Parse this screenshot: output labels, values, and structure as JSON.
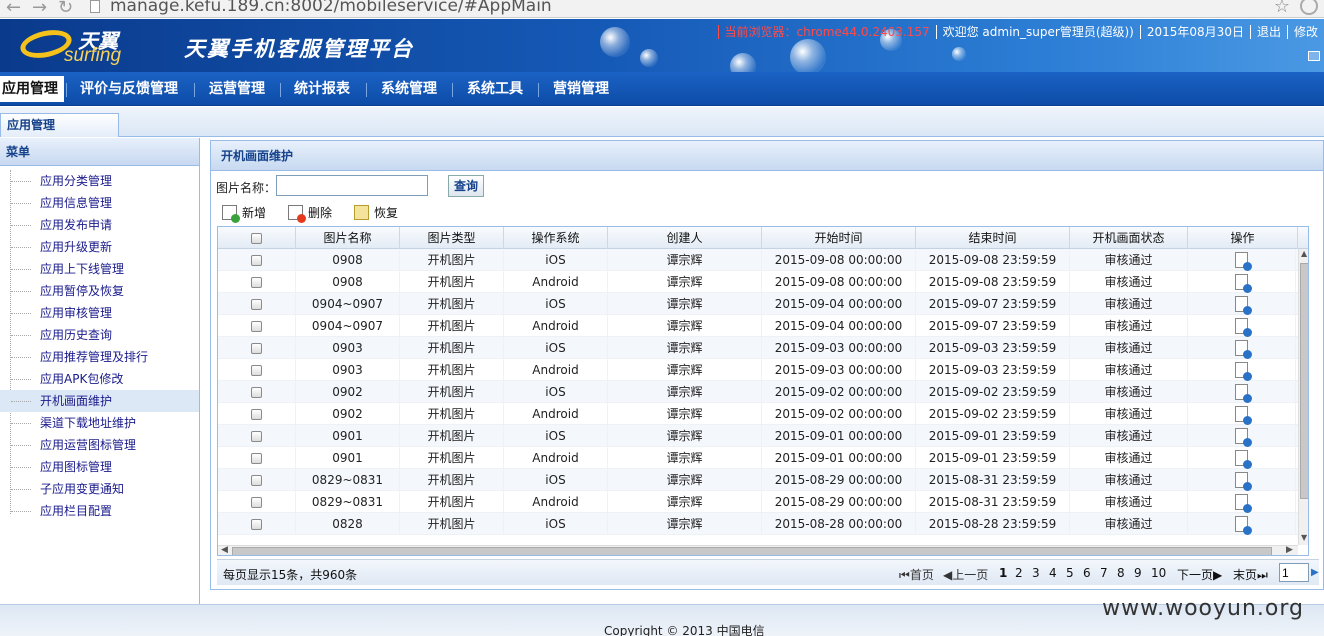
{
  "browser": {
    "url": "manage.kefu.189.cn:8002/mobileservice/#AppMain"
  },
  "header": {
    "logo_cn": "天翼",
    "logo_en": "surfing",
    "platform_title": "天翼手机客服管理平台",
    "browser_info": "当前浏览器：chrome44.0.2403.157",
    "welcome": "欢迎您 admin_super管理员(超级))",
    "date": "2015年08月30日",
    "logout": "退出",
    "change": "修改"
  },
  "mainnav": {
    "items": [
      {
        "label": "应用管理"
      },
      {
        "label": "评价与反馈管理"
      },
      {
        "label": "运营管理"
      },
      {
        "label": "统计报表"
      },
      {
        "label": "系统管理"
      },
      {
        "label": "系统工具"
      },
      {
        "label": "营销管理"
      }
    ]
  },
  "tabstrip": {
    "tab_label": "应用管理"
  },
  "sidebar": {
    "title": "菜单",
    "items": [
      {
        "label": "应用分类管理"
      },
      {
        "label": "应用信息管理"
      },
      {
        "label": "应用发布申请"
      },
      {
        "label": "应用升级更新"
      },
      {
        "label": "应用上下线管理"
      },
      {
        "label": "应用暂停及恢复"
      },
      {
        "label": "应用审核管理"
      },
      {
        "label": "应用历史查询"
      },
      {
        "label": "应用推荐管理及排行"
      },
      {
        "label": "应用APK包修改"
      },
      {
        "label": "开机画面维护"
      },
      {
        "label": "渠道下载地址维护"
      },
      {
        "label": "应用运营图标管理"
      },
      {
        "label": "应用图标管理"
      },
      {
        "label": "子应用变更通知"
      },
      {
        "label": "应用栏目配置"
      }
    ]
  },
  "panel": {
    "title": "开机画面维护",
    "search_label": "图片名称：",
    "search_value": "",
    "search_button": "查询",
    "toolbar": {
      "add": "新增",
      "delete": "删除",
      "restore": "恢复"
    }
  },
  "grid": {
    "columns": [
      "",
      "图片名称",
      "图片类型",
      "操作系统",
      "创建人",
      "开始时间",
      "结束时间",
      "开机画面状态",
      "操作"
    ],
    "rows": [
      [
        "0908",
        "开机图片",
        "iOS",
        "谭宗辉",
        "2015-09-08 00:00:00",
        "2015-09-08 23:59:59",
        "审核通过"
      ],
      [
        "0908",
        "开机图片",
        "Android",
        "谭宗辉",
        "2015-09-08 00:00:00",
        "2015-09-08 23:59:59",
        "审核通过"
      ],
      [
        "0904~0907",
        "开机图片",
        "iOS",
        "谭宗辉",
        "2015-09-04 00:00:00",
        "2015-09-07 23:59:59",
        "审核通过"
      ],
      [
        "0904~0907",
        "开机图片",
        "Android",
        "谭宗辉",
        "2015-09-04 00:00:00",
        "2015-09-07 23:59:59",
        "审核通过"
      ],
      [
        "0903",
        "开机图片",
        "iOS",
        "谭宗辉",
        "2015-09-03 00:00:00",
        "2015-09-03 23:59:59",
        "审核通过"
      ],
      [
        "0903",
        "开机图片",
        "Android",
        "谭宗辉",
        "2015-09-03 00:00:00",
        "2015-09-03 23:59:59",
        "审核通过"
      ],
      [
        "0902",
        "开机图片",
        "iOS",
        "谭宗辉",
        "2015-09-02 00:00:00",
        "2015-09-02 23:59:59",
        "审核通过"
      ],
      [
        "0902",
        "开机图片",
        "Android",
        "谭宗辉",
        "2015-09-02 00:00:00",
        "2015-09-02 23:59:59",
        "审核通过"
      ],
      [
        "0901",
        "开机图片",
        "iOS",
        "谭宗辉",
        "2015-09-01 00:00:00",
        "2015-09-01 23:59:59",
        "审核通过"
      ],
      [
        "0901",
        "开机图片",
        "Android",
        "谭宗辉",
        "2015-09-01 00:00:00",
        "2015-09-01 23:59:59",
        "审核通过"
      ],
      [
        "0829~0831",
        "开机图片",
        "iOS",
        "谭宗辉",
        "2015-08-29 00:00:00",
        "2015-08-31 23:59:59",
        "审核通过"
      ],
      [
        "0829~0831",
        "开机图片",
        "Android",
        "谭宗辉",
        "2015-08-29 00:00:00",
        "2015-08-31 23:59:59",
        "审核通过"
      ],
      [
        "0828",
        "开机图片",
        "iOS",
        "谭宗辉",
        "2015-08-28 00:00:00",
        "2015-08-28 23:59:59",
        "审核通过"
      ]
    ]
  },
  "pager": {
    "summary": "每页显示15条，共960条",
    "first": "首页",
    "prev": "上一页",
    "pages": [
      "1",
      "2",
      "3",
      "4",
      "5",
      "6",
      "7",
      "8",
      "9",
      "10"
    ],
    "current_page": "1",
    "next": "下一页",
    "last": "末页",
    "page_input": "1"
  },
  "footer": {
    "copyright": "Copyright © 2013 中国电信",
    "watermark": "www.wooyun.org"
  }
}
